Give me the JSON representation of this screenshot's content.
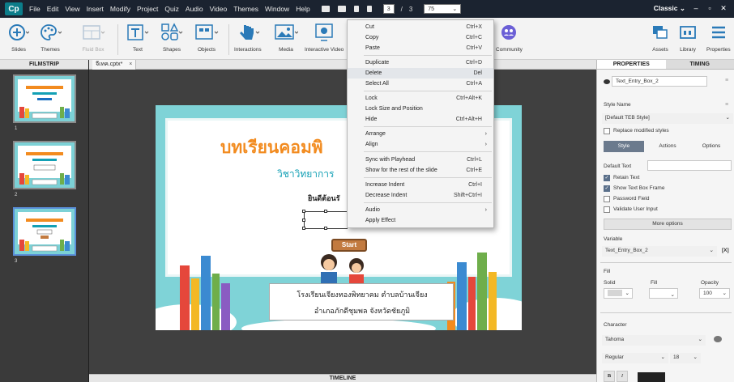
{
  "menubar": {
    "logo": "Cp",
    "menus": [
      "File",
      "Edit",
      "View",
      "Insert",
      "Modify",
      "Project",
      "Quiz",
      "Audio",
      "Video",
      "Themes",
      "Window",
      "Help"
    ],
    "icons": [
      "preview-icon",
      "mail-icon",
      "share-icon",
      "upload-icon"
    ],
    "page_current": "3",
    "page_separator": "/",
    "page_total": "3",
    "zoom": "75",
    "workspace": "Classic",
    "window_controls": [
      "–",
      "▫",
      "✕"
    ]
  },
  "toolbar": {
    "tools": [
      {
        "label": "Slides"
      },
      {
        "label": "Themes"
      },
      {
        "label": "Fluid Box"
      },
      {
        "label": "Text"
      },
      {
        "label": "Shapes"
      },
      {
        "label": "Objects"
      },
      {
        "label": "Interactions"
      },
      {
        "label": "Media"
      },
      {
        "label": "Interactive Video"
      },
      {
        "label": "Community"
      },
      {
        "label": "Assets"
      },
      {
        "label": "Library"
      },
      {
        "label": "Properties"
      }
    ]
  },
  "filmstrip": {
    "header": "FILMSTRIP",
    "slides": [
      "1",
      "2",
      "3"
    ],
    "selected": 3
  },
  "document": {
    "tab_title": "จีเทค.cptx*",
    "tab_close": "×"
  },
  "slide": {
    "title": "บทเรียนคอมพิ",
    "subtitle": "วิชาวิทยาการ",
    "welcome": "ยินดีต้อนรั",
    "start_button": "Start",
    "footer_line1": "โรงเรียนเจียงทองพิทยาคม ตำบลบ้านเจียง",
    "footer_line2": "อำเภอภักดีชุมพล จังหวัดชัยภูมิ"
  },
  "timeline": {
    "label": "TIMELINE"
  },
  "context_menu": {
    "items": [
      {
        "label": "Cut",
        "shortcut": "Ctrl+X"
      },
      {
        "label": "Copy",
        "shortcut": "Ctrl+C"
      },
      {
        "label": "Paste",
        "shortcut": "Ctrl+V"
      },
      {
        "label": "Duplicate",
        "shortcut": "Ctrl+D"
      },
      {
        "label": "Delete",
        "shortcut": "Del"
      },
      {
        "label": "Select All",
        "shortcut": "Ctrl+A"
      },
      {
        "label": "Lock",
        "shortcut": "Ctrl+Alt+K"
      },
      {
        "label": "Lock Size and Position",
        "shortcut": ""
      },
      {
        "label": "Hide",
        "shortcut": "Ctrl+Alt+H"
      },
      {
        "label": "Arrange",
        "shortcut": "",
        "submenu": true
      },
      {
        "label": "Align",
        "shortcut": "",
        "submenu": true
      },
      {
        "label": "Sync with Playhead",
        "shortcut": "Ctrl+L"
      },
      {
        "label": "Show for the rest of the slide",
        "shortcut": "Ctrl+E"
      },
      {
        "label": "Increase Indent",
        "shortcut": "Ctrl+I"
      },
      {
        "label": "Decrease Indent",
        "shortcut": "Shift+Ctrl+I"
      },
      {
        "label": "Audio",
        "shortcut": "",
        "submenu": true
      },
      {
        "label": "Apply Effect",
        "shortcut": ""
      }
    ],
    "highlighted": "Delete",
    "submenu_arrow": "›"
  },
  "properties": {
    "tab_properties": "PROPERTIES",
    "tab_timing": "TIMING",
    "object_name": "Text_Entry_Box_2",
    "style_name_label": "Style Name",
    "style_name_value": "[Default TEB Style]",
    "replace_styles": "Replace modified styles",
    "subtabs": [
      "Style",
      "Actions",
      "Options"
    ],
    "default_text_label": "Default Text",
    "retain_text": "Retain Text",
    "show_frame": "Show Text Box Frame",
    "password_field": "Password Field",
    "validate_input": "Validate User Input",
    "more_options": "More options",
    "variable_label": "Variable",
    "variable_value": "Text_Entry_Box_2",
    "variable_btn": "[X]",
    "fill_label": "Fill",
    "solid_label": "Solid",
    "fill_sub_label": "Fill",
    "opacity_label": "Opacity",
    "opacity_value": "100",
    "character_label": "Character",
    "font_value": "Tahoma",
    "font_style": "Regular",
    "font_size": "18",
    "bold": "B",
    "italic": "I"
  },
  "colors": {
    "menubar_bg": "#1b2330",
    "toolbar_icon_blue": "#2a7ab8",
    "slide_title": "#f28b1f",
    "slide_subtitle": "#13a0b5",
    "start_button": "#c27a3f"
  }
}
